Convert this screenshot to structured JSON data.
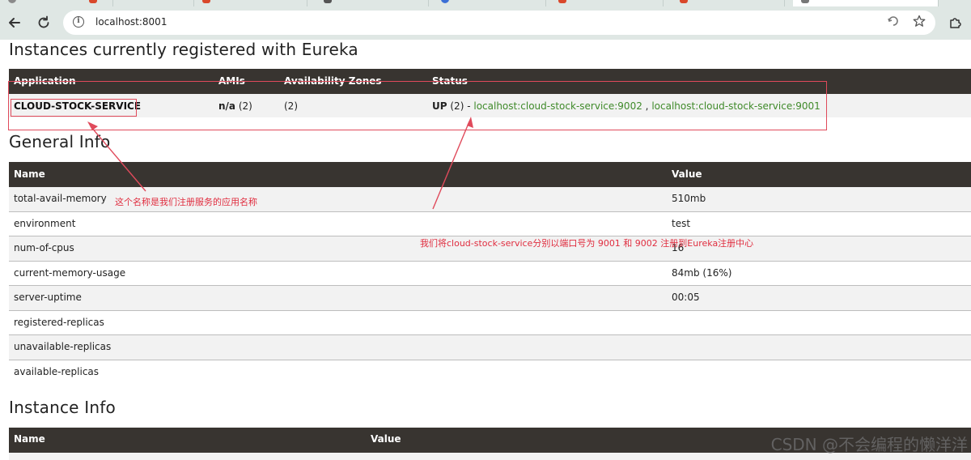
{
  "browser": {
    "url": "localhost:8001"
  },
  "sections": {
    "instances_title": "Instances currently registered with Eureka",
    "general_title": "General Info",
    "instance_info_title": "Instance Info"
  },
  "instances_table": {
    "headers": [
      "Application",
      "AMIs",
      "Availability Zones",
      "Status"
    ],
    "rows": [
      {
        "application": "CLOUD-STOCK-SERVICE",
        "amis_label": "n/a",
        "amis_count": "(2)",
        "zones": "(2)",
        "status_label": "UP",
        "status_count": "(2) -",
        "instance_1": "localhost:cloud-stock-service:9002",
        "separator": ",",
        "instance_2": "localhost:cloud-stock-service:9001"
      }
    ]
  },
  "general_table": {
    "headers": [
      "Name",
      "Value"
    ],
    "rows": [
      {
        "name": "total-avail-memory",
        "value": "510mb"
      },
      {
        "name": "environment",
        "value": "test"
      },
      {
        "name": "num-of-cpus",
        "value": "16"
      },
      {
        "name": "current-memory-usage",
        "value": "84mb (16%)"
      },
      {
        "name": "server-uptime",
        "value": "00:05"
      },
      {
        "name": "registered-replicas",
        "value": ""
      },
      {
        "name": "unavailable-replicas",
        "value": ""
      },
      {
        "name": "available-replicas",
        "value": ""
      }
    ]
  },
  "instance_info_table": {
    "headers": [
      "Name",
      "Value"
    ]
  },
  "annotations": {
    "app_name_note": "这个名称是我们注册服务的应用名称",
    "ports_note": "我们将cloud-stock-service分别以端口号为 9001 和 9002 注册到Eureka注册中心",
    "color": "#e02d3f"
  },
  "watermark": "CSDN @不会编程的懒洋洋",
  "colors": {
    "table_header_bg": "#383430",
    "status_link": "#3f8a2a",
    "browser_chrome": "#dfe7e4"
  }
}
